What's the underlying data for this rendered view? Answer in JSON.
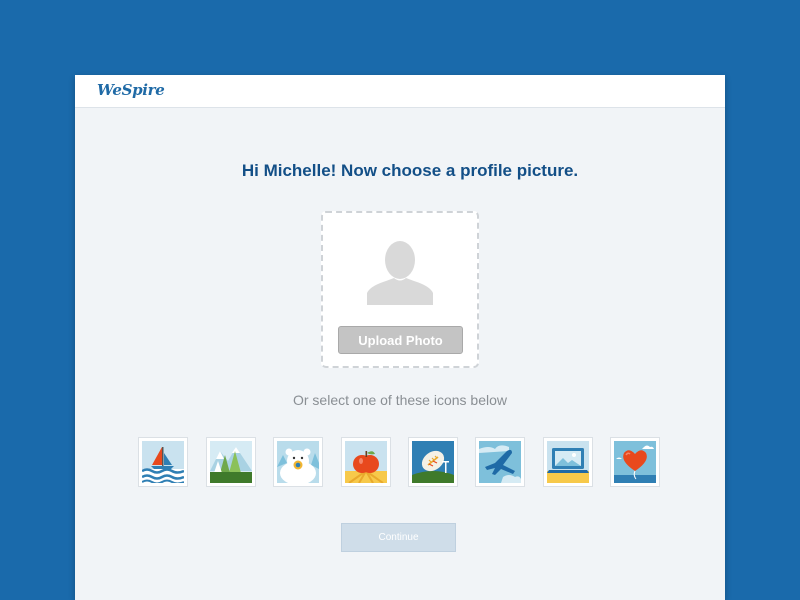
{
  "app": {
    "brand": "WeSpire"
  },
  "main": {
    "heading": "Hi Michelle! Now choose a profile picture.",
    "upload_button_label": "Upload Photo",
    "or_text": "Or select one of these icons below",
    "continue_label": "Continue"
  },
  "icons": [
    "sailboat-icon",
    "mountains-icon",
    "polar-bear-icon",
    "apple-icon",
    "football-icon",
    "airplane-icon",
    "laptop-icon",
    "heart-balloon-icon"
  ],
  "colors": {
    "background": "#1a6aab",
    "heading": "#134f87",
    "upload_button": "#c4c4c4",
    "continue_button_disabled": "#cfdde9"
  }
}
